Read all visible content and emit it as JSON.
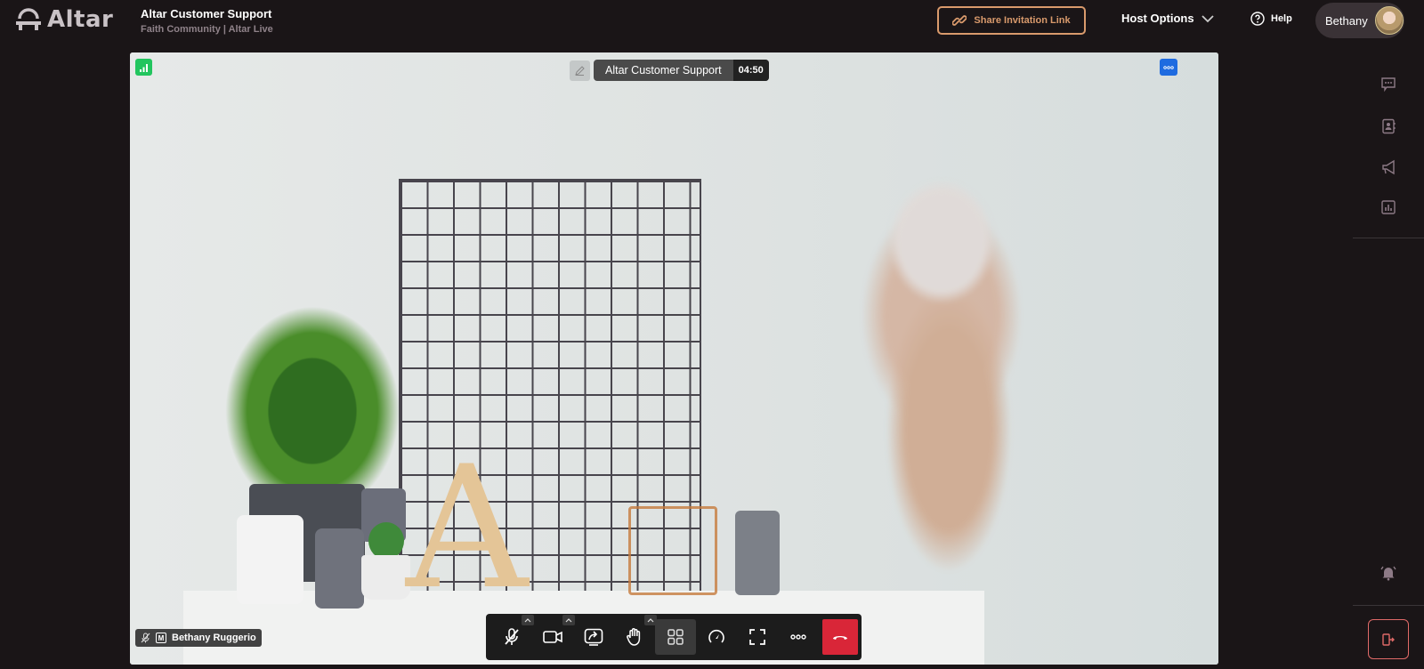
{
  "app": {
    "logo_text": "Altar",
    "meeting_title": "Altar Customer Support",
    "meeting_subtitle": "Faith Community | Altar Live"
  },
  "header": {
    "share_label": "Share Invitation Link",
    "host_options_label": "Host Options",
    "help_label": "Help",
    "user_name": "Bethany"
  },
  "video": {
    "room_title": "Altar Customer Support",
    "elapsed": "04:50",
    "participant_name": "Bethany Ruggerio",
    "participant_badge": "M"
  },
  "controls": [
    {
      "id": "mic",
      "icon": "mic-off-icon",
      "has_caret": true
    },
    {
      "id": "camera",
      "icon": "video-camera-icon",
      "has_caret": true
    },
    {
      "id": "share-screen",
      "icon": "share-screen-icon",
      "has_caret": false
    },
    {
      "id": "raise-hand",
      "icon": "hand-icon",
      "has_caret": true
    },
    {
      "id": "layout",
      "icon": "grid-layout-icon",
      "has_caret": false,
      "active": true
    },
    {
      "id": "stats",
      "icon": "speedometer-icon",
      "has_caret": false
    },
    {
      "id": "fullscreen",
      "icon": "fullscreen-icon",
      "has_caret": false
    },
    {
      "id": "more",
      "icon": "ellipsis-icon",
      "has_caret": false
    },
    {
      "id": "end-call",
      "icon": "phone-hangup-icon",
      "has_caret": false
    }
  ],
  "sidebar": [
    {
      "id": "chat",
      "icon": "chat-icon"
    },
    {
      "id": "contacts",
      "icon": "contact-book-icon"
    },
    {
      "id": "announcements",
      "icon": "megaphone-icon"
    },
    {
      "id": "polls",
      "icon": "bar-chart-icon"
    },
    {
      "id": "alerts",
      "icon": "bell-ring-icon"
    },
    {
      "id": "leave",
      "icon": "exit-door-icon"
    }
  ],
  "colors": {
    "background": "#1a1517",
    "accent_orange": "#d99a6c",
    "signal_green": "#22c55e",
    "menu_blue": "#1e6be0",
    "end_call_red": "#d92638",
    "leave_red": "#e06a68",
    "rail_icon": "#8d7a86"
  }
}
